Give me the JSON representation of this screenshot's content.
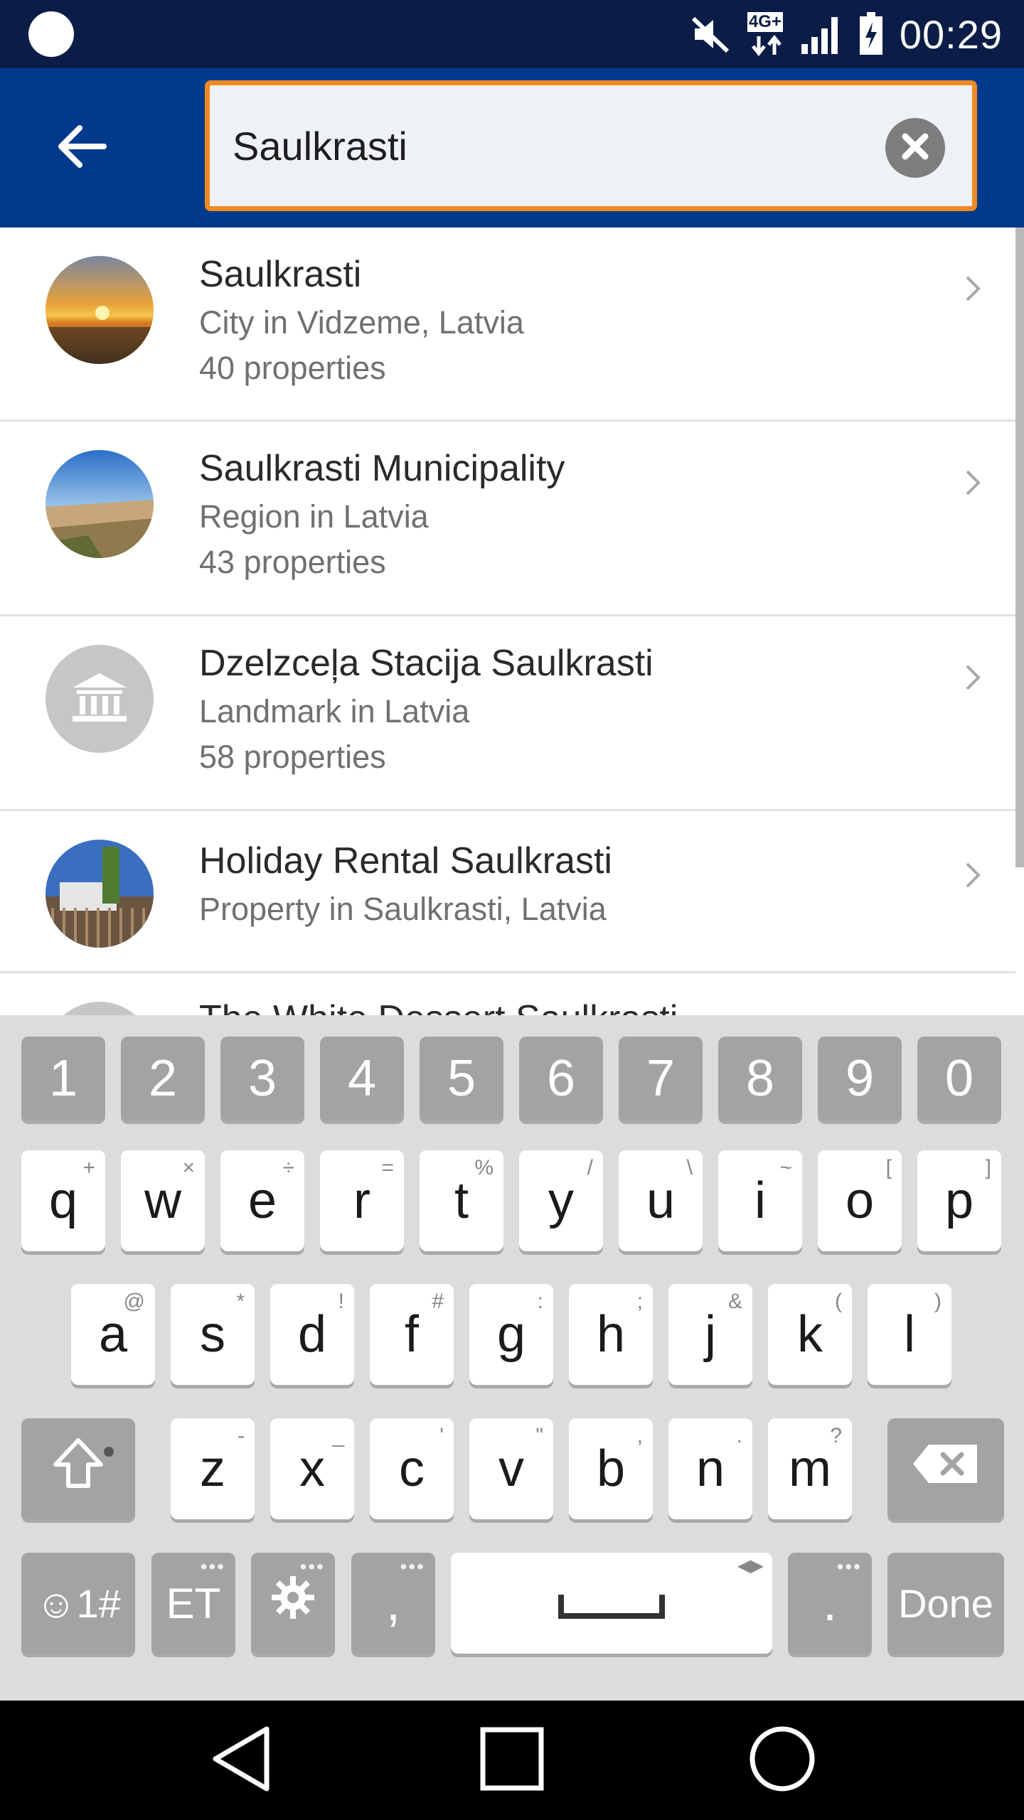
{
  "status_bar": {
    "network": "4G+",
    "time": "00:29",
    "icons": [
      "notification-dot-icon",
      "mute-icon",
      "network-4g-icon",
      "signal-icon",
      "battery-charging-icon"
    ]
  },
  "search": {
    "value": "Saulkrasti",
    "icons": [
      "back-arrow-icon",
      "clear-icon"
    ]
  },
  "results": [
    {
      "title": "Saulkrasti",
      "subtitle": "City in Vidzeme, Latvia",
      "count": "40 properties",
      "thumb": "sunset-photo"
    },
    {
      "title": "Saulkrasti Municipality",
      "subtitle": "Region in Latvia",
      "count": "43 properties",
      "thumb": "beach-photo"
    },
    {
      "title": "Dzelzceļa Stacija Saulkrasti",
      "subtitle": "Landmark in Latvia",
      "count": "58 properties",
      "thumb": "landmark-icon"
    },
    {
      "title": "Holiday Rental Saulkrasti",
      "subtitle": "Property in Saulkrasti, Latvia",
      "count": "",
      "thumb": "house-photo"
    },
    {
      "title": "The White Dessert Saulkrasti",
      "subtitle": "",
      "count": "",
      "thumb": "partial"
    }
  ],
  "keyboard": {
    "numbers": [
      "1",
      "2",
      "3",
      "4",
      "5",
      "6",
      "7",
      "8",
      "9",
      "0"
    ],
    "row1": [
      {
        "k": "q",
        "h": "+"
      },
      {
        "k": "w",
        "h": "×"
      },
      {
        "k": "e",
        "h": "÷"
      },
      {
        "k": "r",
        "h": "="
      },
      {
        "k": "t",
        "h": "%"
      },
      {
        "k": "y",
        "h": "/"
      },
      {
        "k": "u",
        "h": "\\"
      },
      {
        "k": "i",
        "h": "~"
      },
      {
        "k": "o",
        "h": "["
      },
      {
        "k": "p",
        "h": "]"
      }
    ],
    "row2": [
      {
        "k": "a",
        "h": "@"
      },
      {
        "k": "s",
        "h": "*"
      },
      {
        "k": "d",
        "h": "!"
      },
      {
        "k": "f",
        "h": "#"
      },
      {
        "k": "g",
        "h": ":"
      },
      {
        "k": "h",
        "h": ";"
      },
      {
        "k": "j",
        "h": "&"
      },
      {
        "k": "k",
        "h": "("
      },
      {
        "k": "l",
        "h": ")"
      }
    ],
    "row3": [
      {
        "k": "z",
        "h": "-"
      },
      {
        "k": "x",
        "h": "_"
      },
      {
        "k": "c",
        "h": "'"
      },
      {
        "k": "v",
        "h": "\""
      },
      {
        "k": "b",
        "h": ","
      },
      {
        "k": "n",
        "h": "."
      },
      {
        "k": "m",
        "h": "?"
      }
    ],
    "symbols_label": "☺1#",
    "language_label": "ET",
    "comma_label": ",",
    "period_label": ".",
    "done_label": "Done"
  }
}
